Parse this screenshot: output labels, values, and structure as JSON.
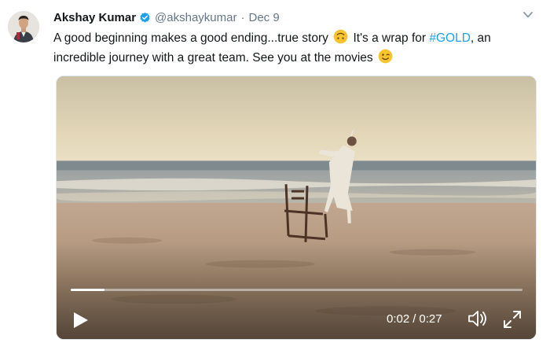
{
  "tweet": {
    "author_name": "Akshay Kumar",
    "handle": "@akshaykumar",
    "separator": "·",
    "date": "Dec 9",
    "text_part1": "A good beginning makes a good ending...true story",
    "text_part2": " It's a wrap for ",
    "hashtag": "#GOLD",
    "text_part3": ", an incredible journey with a great team. See you at the movies",
    "emoji_1": "upside-down-face",
    "emoji_2": "winking-face"
  },
  "video": {
    "current_time": "0:02",
    "time_separator": "/",
    "duration": "0:27",
    "progress_fraction": 0.074
  },
  "icons": {
    "verified": "verified-badge-icon",
    "menu": "chevron-down-icon",
    "play": "play-icon",
    "volume": "volume-muted-icon",
    "fullscreen": "fullscreen-icon"
  },
  "colors": {
    "link": "#1da1f2",
    "text": "#14171a",
    "muted": "#657786"
  }
}
